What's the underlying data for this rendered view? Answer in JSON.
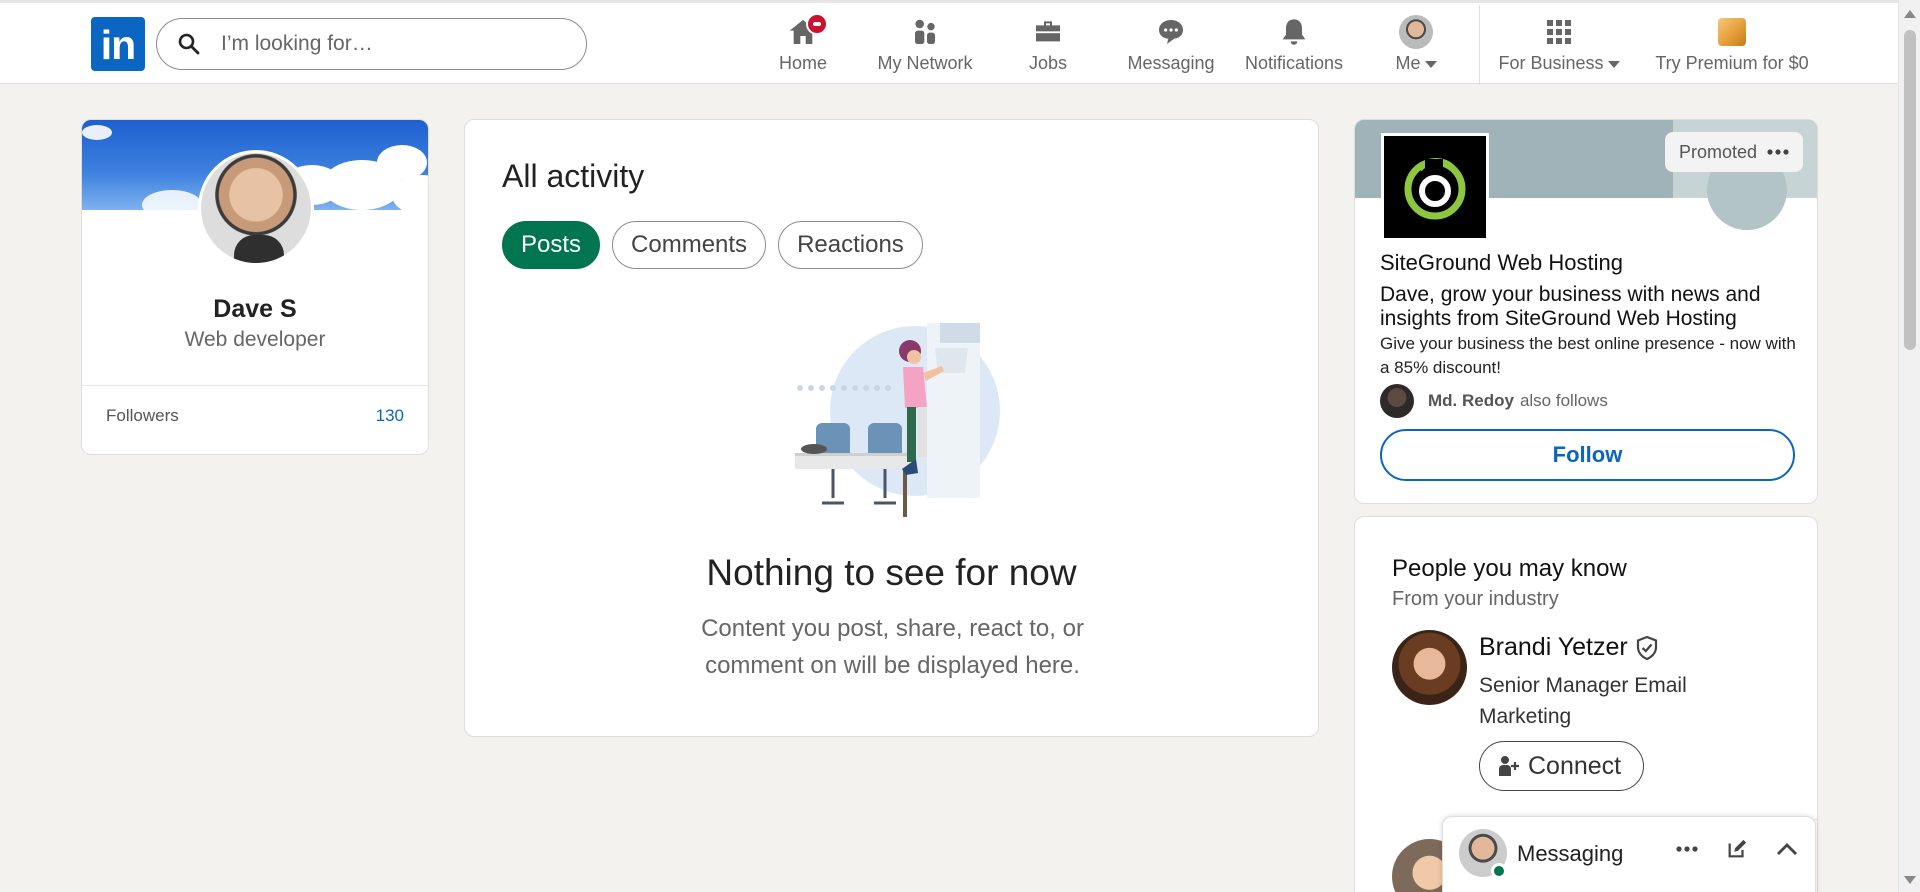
{
  "nav": {
    "logo_text": "in",
    "search_placeholder": "I’m looking for…",
    "items": [
      {
        "label": "Home",
        "icon": "home-icon",
        "badge": true
      },
      {
        "label": "My Network",
        "icon": "network-icon"
      },
      {
        "label": "Jobs",
        "icon": "briefcase-icon"
      },
      {
        "label": "Messaging",
        "icon": "chat-icon"
      },
      {
        "label": "Notifications",
        "icon": "bell-icon"
      },
      {
        "label": "Me",
        "icon": "avatar"
      },
      {
        "label": "For Business",
        "icon": "grid-icon"
      },
      {
        "label": "Try Premium for $0",
        "icon": "premium-icon"
      }
    ]
  },
  "profile": {
    "name": "Dave S",
    "title": "Web developer",
    "followers_label": "Followers",
    "followers_count": "130"
  },
  "activity": {
    "title": "All activity",
    "tabs": [
      "Posts",
      "Comments",
      "Reactions"
    ],
    "active_tab": "Posts",
    "empty_title": "Nothing to see for now",
    "empty_text": "Content you post, share, react to, or comment on will be displayed here."
  },
  "ad": {
    "promoted_label": "Promoted",
    "company": "SiteGround Web Hosting",
    "headline": "Dave, grow your business with news and insights from SiteGround Web Hosting",
    "body": "Give your business the best online presence - now with a 85% discount!",
    "social_name": "Md. Redoy",
    "social_suffix": "also follows",
    "follow_label": "Follow",
    "brand_color": "#8dc63f"
  },
  "pymk": {
    "title": "People you may know",
    "subtitle": "From your industry",
    "person": {
      "name": "Brandi Yetzer",
      "role": "Senior Manager Email Marketing",
      "connect_label": "Connect"
    }
  },
  "messaging": {
    "title": "Messaging"
  },
  "colors": {
    "linkedin_blue": "#0a66c2",
    "active_pill": "#01754f",
    "badge_red": "#cb112d",
    "background": "#f4f2ee"
  }
}
